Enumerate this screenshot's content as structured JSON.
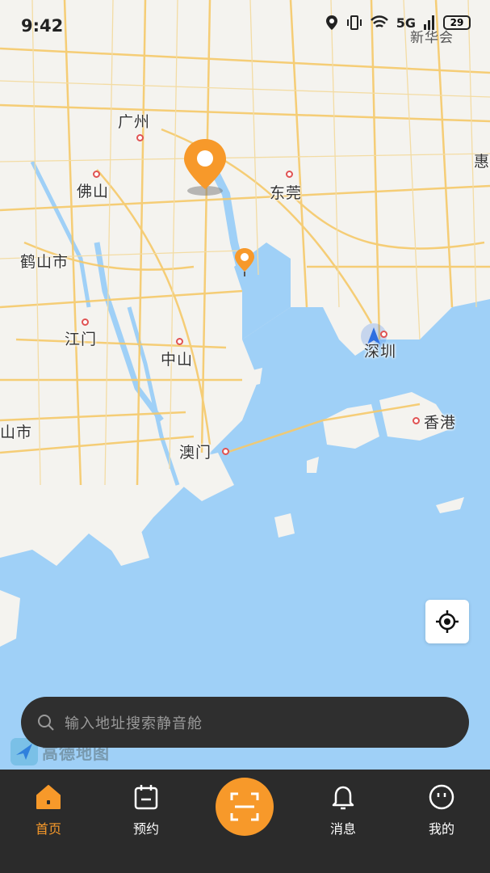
{
  "status_bar": {
    "time": "9:42",
    "network": "5G",
    "battery": "29",
    "carrier_overlay": "新华会"
  },
  "map": {
    "cities": [
      {
        "name": "广州",
        "id": "guangzhou"
      },
      {
        "name": "佛山",
        "id": "foshan"
      },
      {
        "name": "东莞",
        "id": "dongguan"
      },
      {
        "name": "鹤山市",
        "id": "heshan"
      },
      {
        "name": "江门",
        "id": "jiangmen"
      },
      {
        "name": "中山",
        "id": "zhongshan"
      },
      {
        "name": "深圳",
        "id": "shenzhen"
      },
      {
        "name": "香港",
        "id": "hongkong"
      },
      {
        "name": "澳门",
        "id": "macau"
      },
      {
        "name": "惠",
        "id": "huizhou-partial"
      },
      {
        "name": "山市",
        "id": "city-partial-left"
      }
    ],
    "logo_text": "高德地图",
    "colors": {
      "land": "#f4f3ef",
      "water": "#9fd0f7",
      "road": "#f6c96a",
      "marker": "#f7992a"
    }
  },
  "search": {
    "placeholder": "输入地址搜索静音舱"
  },
  "tabs": [
    {
      "label": "首页",
      "icon": "home-icon",
      "active": true
    },
    {
      "label": "预约",
      "icon": "calendar-icon",
      "active": false
    },
    {
      "label": "消息",
      "icon": "bell-icon",
      "active": false
    },
    {
      "label": "我的",
      "icon": "smiley-icon",
      "active": false
    }
  ],
  "scan": {
    "icon": "scan-icon"
  },
  "accent_color": "#f7992a"
}
